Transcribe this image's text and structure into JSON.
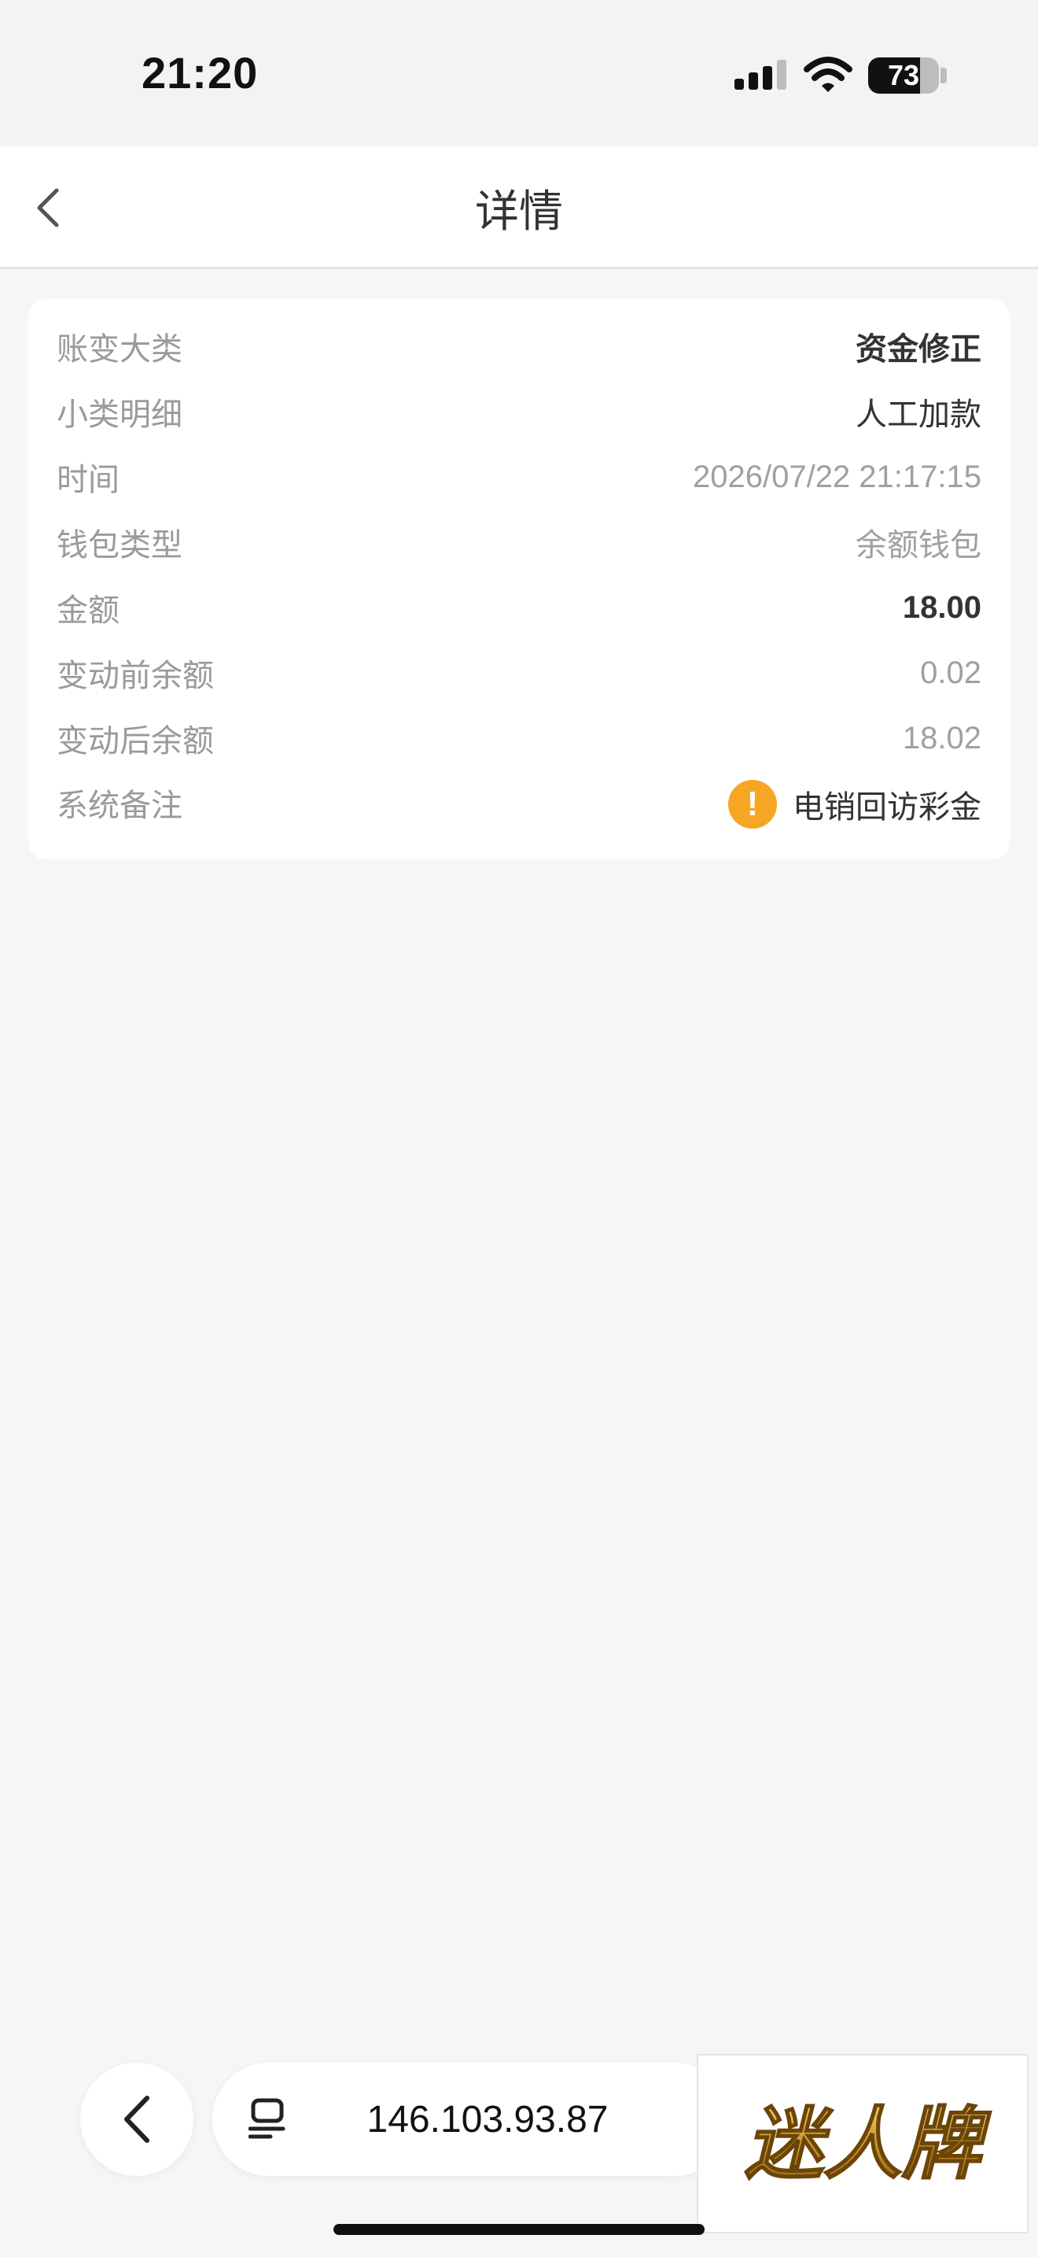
{
  "status_bar": {
    "time": "21:20",
    "battery_level": "73",
    "battery_fraction": 0.73
  },
  "nav": {
    "title": "详情",
    "back_icon": "chevron-left-icon"
  },
  "details": [
    {
      "label": "账变大类",
      "value": "资金修正",
      "style": "bold"
    },
    {
      "label": "小类明细",
      "value": "人工加款",
      "style": "dark"
    },
    {
      "label": "时间",
      "value": "2026/07/22 21:17:15",
      "style": "muted"
    },
    {
      "label": "钱包类型",
      "value": "余额钱包",
      "style": "muted"
    },
    {
      "label": "金额",
      "value": "18.00",
      "style": "bold"
    },
    {
      "label": "变动前余额",
      "value": "0.02",
      "style": "muted"
    },
    {
      "label": "变动后余额",
      "value": "18.02",
      "style": "muted"
    },
    {
      "label": "系统备注",
      "value": "电销回访彩金",
      "style": "dark",
      "icon": "warning-icon"
    }
  ],
  "browser_bar": {
    "url": "146.103.93.87",
    "back_icon": "chevron-left-icon",
    "tab_icon": "tabs-icon"
  },
  "brand": {
    "logo_text": "迷人牌",
    "logo_color": "#c9962a"
  },
  "colors": {
    "warning": "#f5a623",
    "background": "#f6f6f6"
  }
}
